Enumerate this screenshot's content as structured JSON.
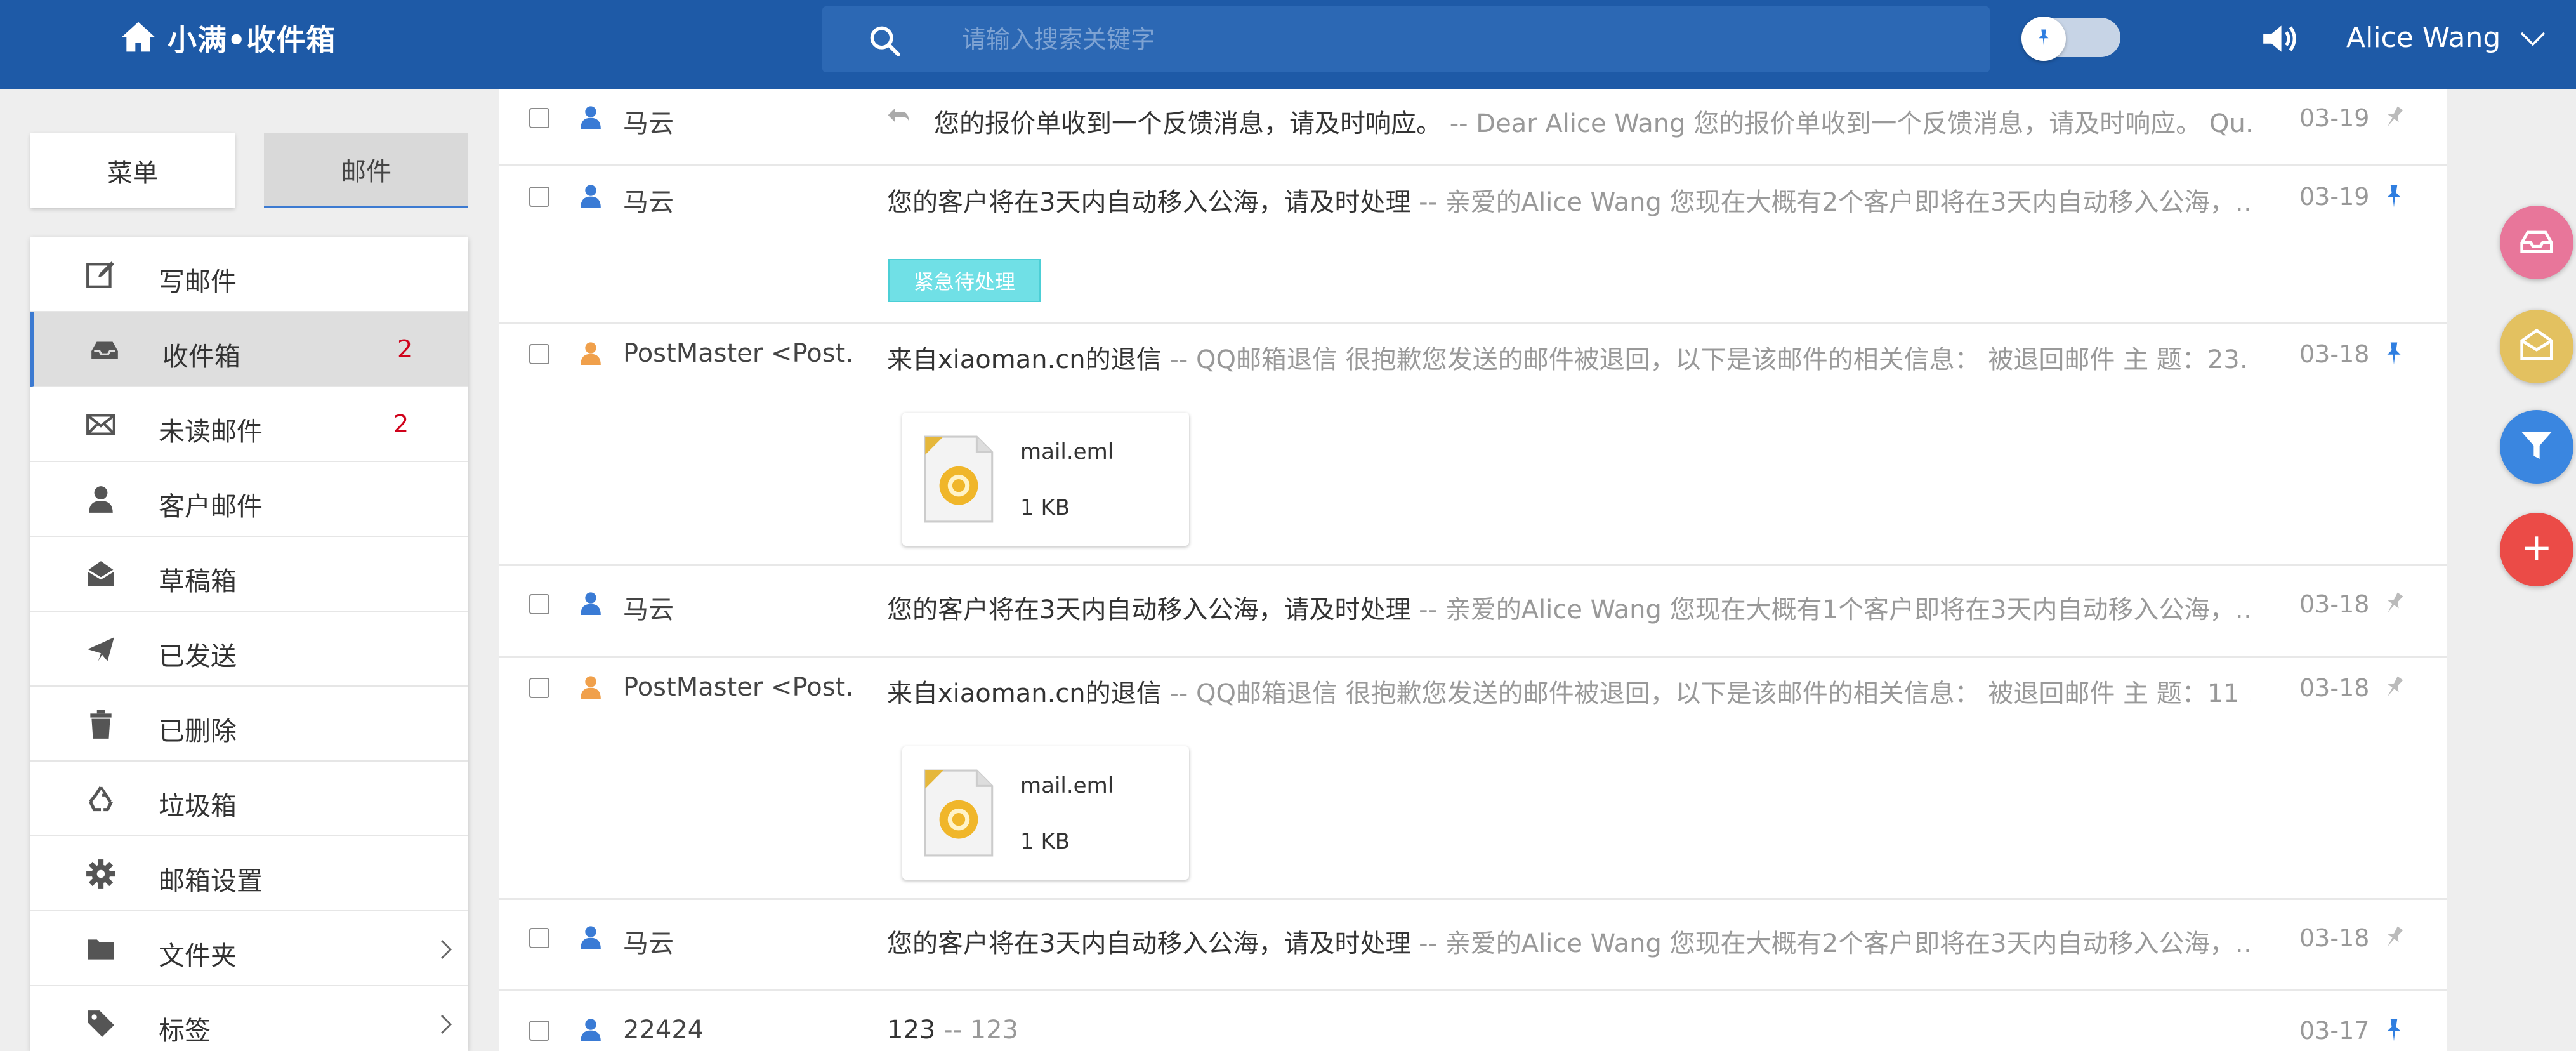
{
  "header": {
    "brand": "小满•收件箱",
    "search_placeholder": "请输入搜索关键字",
    "user_name": "Alice Wang"
  },
  "tabs": {
    "menu": "菜单",
    "mail": "邮件"
  },
  "menu": {
    "items": [
      {
        "label": "写邮件",
        "icon": "compose-icon"
      },
      {
        "label": "收件箱",
        "icon": "inbox-icon",
        "count": "2"
      },
      {
        "label": "未读邮件",
        "icon": "envelope-icon",
        "count": "2"
      },
      {
        "label": "客户邮件",
        "icon": "person-icon"
      },
      {
        "label": "草稿箱",
        "icon": "open-envelope-icon"
      },
      {
        "label": "已发送",
        "icon": "paper-plane-icon"
      },
      {
        "label": "已删除",
        "icon": "trash-icon"
      },
      {
        "label": "垃圾箱",
        "icon": "recycle-icon"
      },
      {
        "label": "邮箱设置",
        "icon": "gear-icon"
      },
      {
        "label": "文件夹",
        "icon": "folder-icon"
      },
      {
        "label": "标签",
        "icon": "tag-icon"
      }
    ]
  },
  "mails": [
    {
      "sender": "马云",
      "subject": "您的报价单收到一个反馈消息，请及时响应。",
      "preview": " -- Dear Alice Wang 您的报价单收到一个反馈消息，请及时响应。 Qu…",
      "date": "03-19",
      "pinned": false,
      "replied": true,
      "person_color": "#3a7bd5"
    },
    {
      "sender": "马云",
      "subject": "您的客户将在3天内自动移入公海，请及时处理",
      "preview": " -- 亲爱的Alice Wang 您现在大概有2个客户即将在3天内自动移入公海，…",
      "date": "03-19",
      "pinned": true,
      "tag": "紧急待处理",
      "person_color": "#3a7bd5"
    },
    {
      "sender": "PostMaster <Post…",
      "subject": "来自xiaoman.cn的退信",
      "preview": " -- QQ邮箱退信 很抱歉您发送的邮件被退回，以下是该邮件的相关信息： 被退回邮件 主 题：23…",
      "date": "03-18",
      "pinned": true,
      "attachment": {
        "name": "mail.eml",
        "size": "1 KB"
      },
      "person_color": "#f0a04b"
    },
    {
      "sender": "马云",
      "subject": "您的客户将在3天内自动移入公海，请及时处理",
      "preview": " -- 亲爱的Alice Wang 您现在大概有1个客户即将在3天内自动移入公海，…",
      "date": "03-18",
      "pinned": false,
      "person_color": "#3a7bd5"
    },
    {
      "sender": "PostMaster <Post…",
      "subject": "来自xiaoman.cn的退信",
      "preview": " -- QQ邮箱退信 很抱歉您发送的邮件被退回，以下是该邮件的相关信息： 被退回邮件 主 题：11 …",
      "date": "03-18",
      "pinned": false,
      "attachment": {
        "name": "mail.eml",
        "size": "1 KB"
      },
      "person_color": "#f0a04b"
    },
    {
      "sender": "马云",
      "subject": "您的客户将在3天内自动移入公海，请及时处理",
      "preview": " -- 亲爱的Alice Wang 您现在大概有2个客户即将在3天内自动移入公海，…",
      "date": "03-18",
      "pinned": false,
      "person_color": "#3a7bd5"
    },
    {
      "sender": "22424",
      "subject": "123",
      "preview": " -- 123",
      "date": "03-17",
      "pinned": true,
      "person_color": "#3a7bd5"
    }
  ],
  "fabs": [
    {
      "icon": "inbox-tray-icon",
      "color": "#e8769a"
    },
    {
      "icon": "open-mail-icon",
      "color": "#e3c160"
    },
    {
      "icon": "filter-icon",
      "color": "#3a86e0"
    },
    {
      "icon": "plus-icon",
      "color": "#eb4b47"
    }
  ],
  "colors": {
    "header": "#1e5aa7",
    "accent": "#3c7ad1",
    "count": "#d0021b",
    "pin_active": "#2f7ee0",
    "pin_inactive": "#bbbbbb"
  }
}
